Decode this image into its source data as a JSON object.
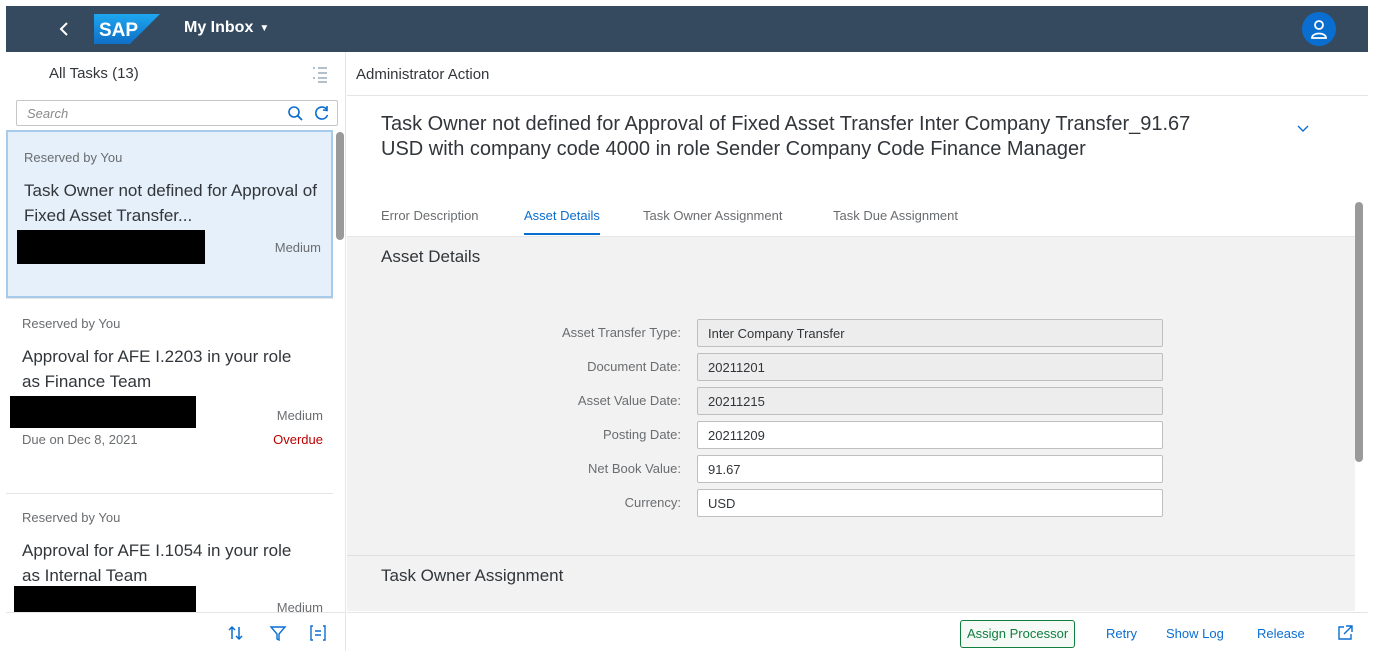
{
  "shell": {
    "title": "My Inbox",
    "logo_text": "SAP",
    "colors": {
      "shell_bg": "#354a5f",
      "avatar_bg": "#0a6ed1"
    }
  },
  "master": {
    "title": "All Tasks (13)",
    "search_placeholder": "Search",
    "items": [
      {
        "reserved": "Reserved by You",
        "title": "Task Owner not defined for Approval of Fixed Asset Transfer...",
        "priority": "Medium",
        "selected": true
      },
      {
        "reserved": "Reserved by You",
        "title": "Approval for AFE I.2203 in your role as Finance Team",
        "priority": "Medium",
        "due": "Due on Dec 8, 2021",
        "status": "Overdue"
      },
      {
        "reserved": "Reserved by You",
        "title": "Approval for AFE I.1054 in your role as Internal Team",
        "priority": "Medium"
      }
    ]
  },
  "detail": {
    "header": "Administrator Action",
    "object_title": "Task Owner not defined for Approval of Fixed Asset Transfer Inter Company Transfer_91.67 USD with company code 4000 in role Sender Company Code Finance Manager",
    "tabs": [
      {
        "label": "Error Description"
      },
      {
        "label": "Asset Details",
        "active": true
      },
      {
        "label": "Task Owner Assignment"
      },
      {
        "label": "Task Due Assignment"
      }
    ],
    "section_title": "Asset Details",
    "fields": [
      {
        "label": "Asset Transfer Type:",
        "value": "Inter Company Transfer"
      },
      {
        "label": "Document Date:",
        "value": "20211201"
      },
      {
        "label": "Asset Value Date:",
        "value": "20211215"
      },
      {
        "label": "Posting Date:",
        "value": "20211209"
      },
      {
        "label": "Net Book Value:",
        "value": "91.67"
      },
      {
        "label": "Currency:",
        "value": "USD"
      }
    ],
    "section2_title": "Task Owner Assignment"
  },
  "footer": {
    "assign_processor": "Assign Processor",
    "retry": "Retry",
    "show_log": "Show Log",
    "release": "Release"
  }
}
